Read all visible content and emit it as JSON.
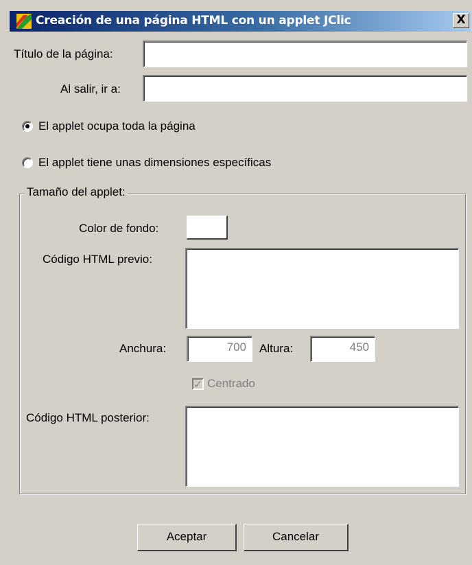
{
  "window": {
    "title": "Creación de una página HTML con un applet JClic",
    "close_glyph": "X"
  },
  "form": {
    "page_title_label": "Título de la página:",
    "page_title_value": "",
    "on_exit_label": "Al salir, ir a:",
    "on_exit_value": ""
  },
  "options": {
    "full_page_label": "El applet ocupa toda la página",
    "full_page_checked": true,
    "specific_dims_label": "El applet tiene unas dimensiones específicas",
    "specific_dims_checked": false
  },
  "applet_size": {
    "group_title": "Tamaño del applet:",
    "bg_color_label": "Color de fondo:",
    "bg_color_value": "#ffffff",
    "html_before_label": "Código HTML previo:",
    "width_label": "Anchura:",
    "width_value": "700",
    "height_label": "Altura:",
    "height_value": "450",
    "centered_label": "Centrado",
    "centered_checked": true,
    "html_after_label": "Código HTML posterior:"
  },
  "buttons": {
    "accept": "Aceptar",
    "cancel": "Cancelar"
  },
  "icons": {
    "app": "jclic-app-icon",
    "close": "close-icon"
  }
}
